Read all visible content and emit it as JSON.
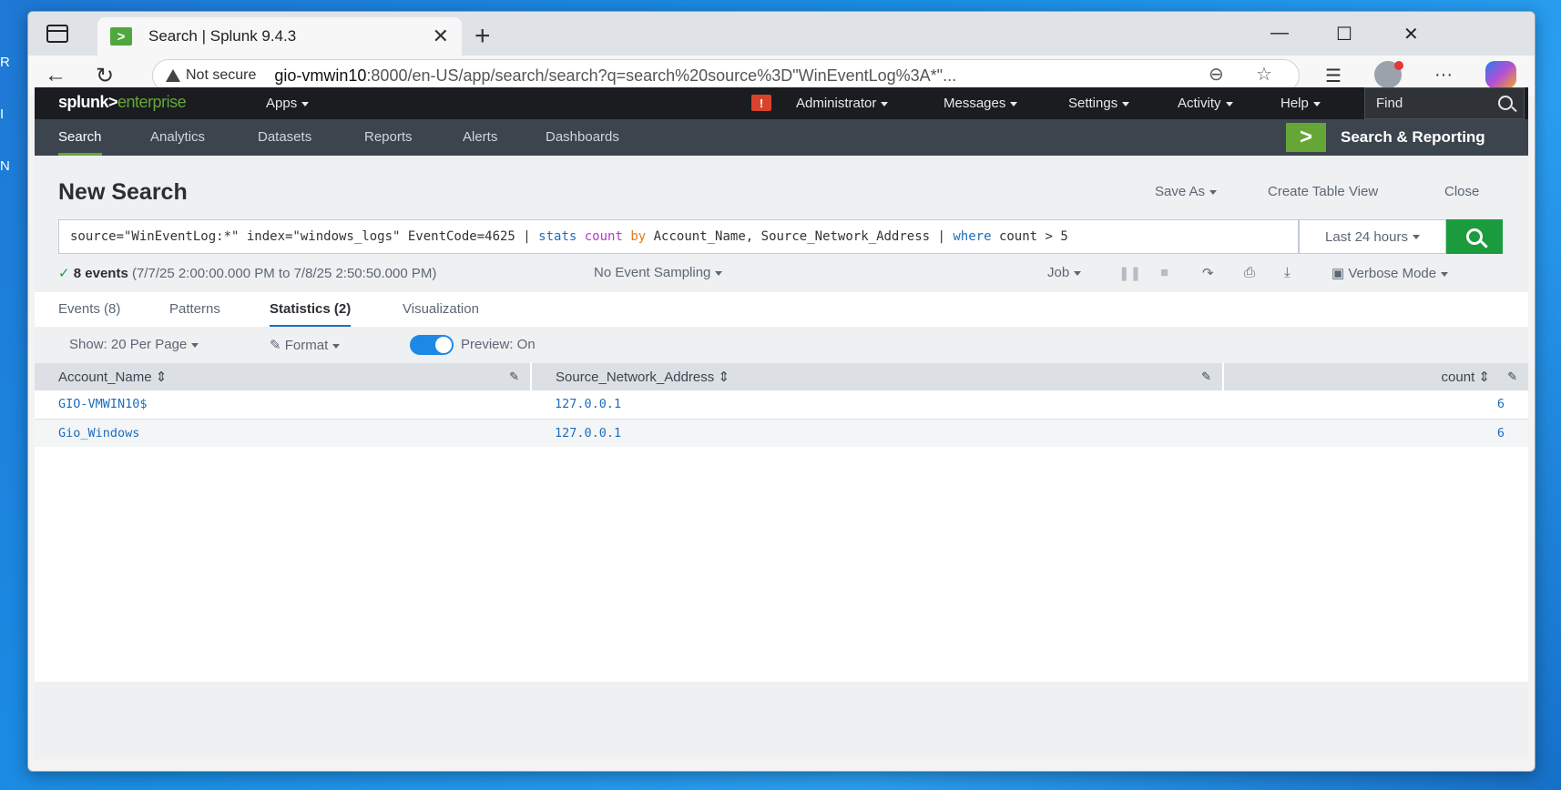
{
  "desktop": {
    "edge_letters": [
      "R",
      "I",
      "N"
    ]
  },
  "browser": {
    "tab_title": "Search | Splunk 9.4.3",
    "tab_favicon": ">",
    "security_label": "Not secure",
    "url_host": "gio-vmwin10",
    "url_rest": ":8000/en-US/app/search/search?q=search%20source%3D\"WinEventLog%3A*\"..."
  },
  "splunk_nav": {
    "logo_main": "splunk>",
    "logo_sub": "enterprise",
    "apps_label": "Apps",
    "alert_badge": "!",
    "menus": [
      "Administrator",
      "Messages",
      "Settings",
      "Activity",
      "Help"
    ],
    "find_label": "Find"
  },
  "app_bar": {
    "tabs": [
      "Search",
      "Analytics",
      "Datasets",
      "Reports",
      "Alerts",
      "Dashboards"
    ],
    "active_tab": "Search",
    "app_logo": ">",
    "app_name": "Search & Reporting"
  },
  "search_page": {
    "title": "New Search",
    "actions": [
      "Save As",
      "Create Table View",
      "Close"
    ],
    "query": {
      "p1": "source=\"WinEventLog:*\" index=\"windows_logs\" EventCode=4625 | ",
      "cmd_stats": "stats",
      "fn_count": "count",
      "kw_by": "by",
      "p2": " Account_Name, Source_Network_Address | ",
      "cmd_where": "where",
      "p3": " count > 5"
    },
    "time_range": "Last 24 hours",
    "status_check": "✓",
    "event_count": "8 events",
    "time_span": "(7/7/25 2:00:00.000 PM to 7/8/25 2:50:50.000 PM)",
    "sampling": "No Event Sampling",
    "job_label": "Job",
    "mode_label": "Verbose Mode"
  },
  "result_tabs": [
    "Events (8)",
    "Patterns",
    "Statistics (2)",
    "Visualization"
  ],
  "active_result_tab": "Statistics (2)",
  "table_controls": {
    "show": "Show: 20 Per Page",
    "format": "Format",
    "preview": "Preview: On"
  },
  "table": {
    "columns": [
      "Account_Name",
      "Source_Network_Address",
      "count"
    ],
    "rows": [
      [
        "GIO-VMWIN10$",
        "127.0.0.1",
        "6"
      ],
      [
        "Gio_Windows",
        "127.0.0.1",
        "6"
      ]
    ]
  }
}
